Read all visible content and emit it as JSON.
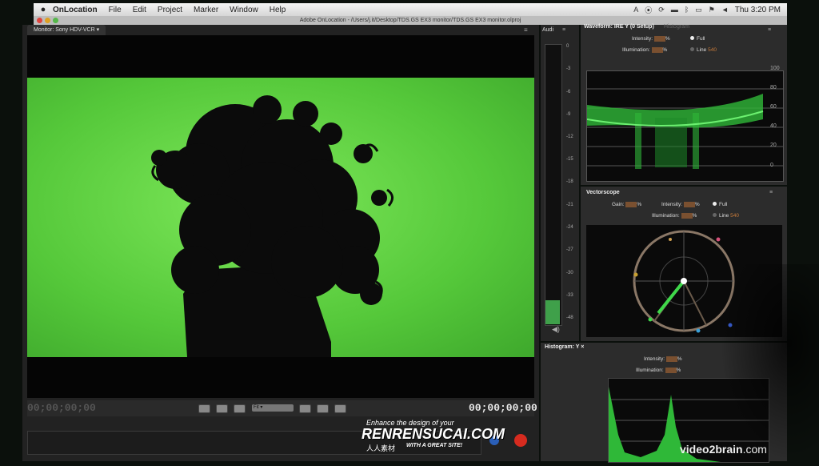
{
  "menubar": {
    "app": "OnLocation",
    "items": [
      "File",
      "Edit",
      "Project",
      "Marker",
      "Window",
      "Help"
    ],
    "clock": "Thu 3:20 PM"
  },
  "window": {
    "title": "Adobe OnLocation - /Users/j.it/Desktop/TDS.GS EX3 monitor/TDS.GS EX3 monitor.olproj"
  },
  "monitor": {
    "tab": "Monitor: Sony HDV-VCR",
    "timecode_left": "00;00;00;00",
    "timecode_right": "00;00;00;00",
    "fit": "Fit"
  },
  "audio": {
    "tab": "Audi",
    "scale": [
      "0",
      "-3",
      "-6",
      "-9",
      "-12",
      "-15",
      "-18",
      "-21",
      "-24",
      "-27",
      "-30",
      "-33",
      "-48"
    ]
  },
  "waveform": {
    "tab": "Waveform: IRE Y (0 Setup)",
    "ghost_tab": "Histogram",
    "intensity_label": "Intensity:",
    "illumination_label": "Illumination:",
    "full_label": "Full",
    "line_label": "Line",
    "line_value": "540",
    "unit": "%",
    "scale": [
      "100",
      "80",
      "60",
      "40",
      "20",
      "0"
    ]
  },
  "vectorscope": {
    "tab": "Vectorscope",
    "gain_label": "Gain:",
    "intensity_label": "Intensity:",
    "illumination_label": "Illumination:",
    "full_label": "Full",
    "line_label": "Line",
    "line_value": "540",
    "unit": "%"
  },
  "histogram": {
    "tab": "Histogram: Y",
    "intensity_label": "Intensity:",
    "illumination_label": "Illumination:",
    "unit": "%"
  },
  "watermark": {
    "line1": "Enhance the design of your",
    "line2": "RENRENSUCAI.COM",
    "line3": "人人素材",
    "line4": "WITH A GREAT SITE!"
  },
  "brand": {
    "name": "video2brain",
    "suffix": ".com"
  },
  "colors": {
    "greenscreen": "#55c83a",
    "waveform_trace": "#3fd84a",
    "record": "#d62b1f"
  }
}
